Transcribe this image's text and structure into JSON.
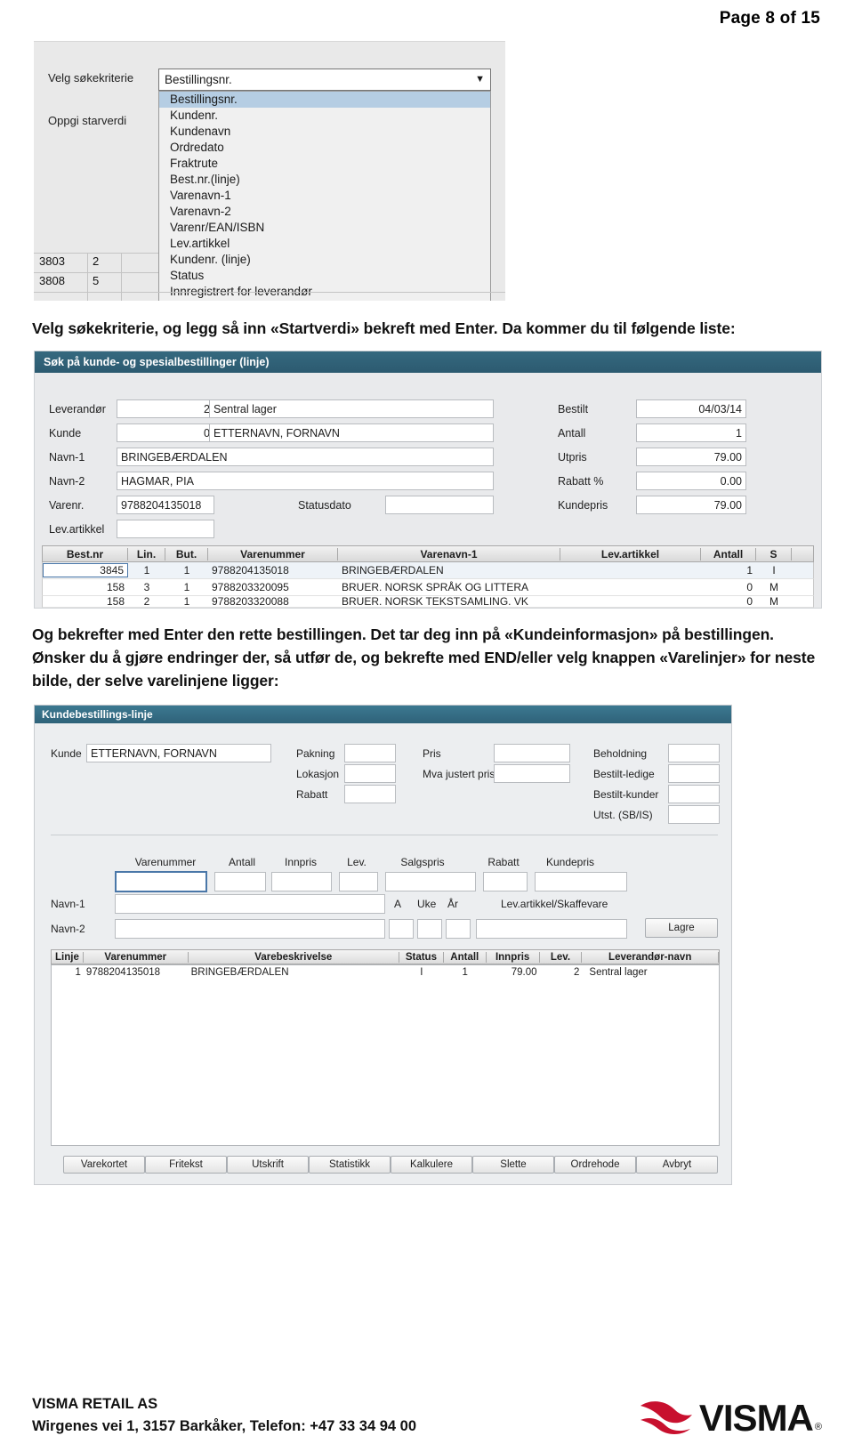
{
  "page": {
    "header": "Page 8 of 15"
  },
  "shot1": {
    "labels": {
      "criteria": "Velg søkekriterie",
      "startvalue": "Oppgi starverdi"
    },
    "combo_value": "Bestillingsnr.",
    "arrow_icon": "chevron-down-icon",
    "options": [
      "Bestillingsnr.",
      "Kundenr.",
      "Kundenavn",
      "Ordredato",
      "Fraktrute",
      "Best.nr.(linje)",
      "Varenavn-1",
      "Varenavn-2",
      "Varenr/EAN/ISBN",
      "Lev.artikkel",
      "Kundenr. (linje)",
      "Status",
      "Innregistrert for leverandør"
    ],
    "selected_option": "Bestillingsnr.",
    "partial_rows": [
      {
        "a": "3803",
        "b": "2"
      },
      {
        "a": "3808",
        "b": "5"
      }
    ]
  },
  "paragraph1": "Velg søkekriterie, og legg så inn «Startverdi» bekreft med Enter. Da kommer du til følgende liste:",
  "paragraph2": "Og bekrefter med Enter den rette bestillingen. Det tar deg inn på «Kundeinformasjon» på bestillingen. Ønsker du å gjøre endringer der, så utfør de, og bekrefte med END/eller velg knappen «Varelinjer» for neste bilde, der selve varelinjene ligger:",
  "shot2": {
    "title": "Søk på kunde- og spesialbestillinger (linje)",
    "labels": {
      "leverandor": "Leverandør",
      "kunde": "Kunde",
      "navn1": "Navn-1",
      "navn2": "Navn-2",
      "varenr": "Varenr.",
      "levartikkel": "Lev.artikkel",
      "statusdato": "Statusdato",
      "bestilt": "Bestilt",
      "antall": "Antall",
      "utpris": "Utpris",
      "rabatt": "Rabatt %",
      "kundepris": "Kundepris"
    },
    "values": {
      "leverandor_nr": "2",
      "leverandor_navn": "Sentral lager",
      "kunde_nr": "0",
      "kunde_navn": "ETTERNAVN, FORNAVN",
      "navn1": "BRINGEBÆRDALEN",
      "navn2": "HAGMAR, PIA",
      "varenr": "9788204135018",
      "levartikkel": "",
      "statusdato": "",
      "bestilt": "04/03/14",
      "antall": "1",
      "utpris": "79.00",
      "rabatt": "0.00",
      "kundepris": "79.00"
    },
    "table": {
      "columns": [
        "Best.nr",
        "Lin.",
        "But.",
        "Varenummer",
        "Varenavn-1",
        "Lev.artikkel",
        "Antall",
        "S"
      ],
      "rows": [
        {
          "bestnr": "3845",
          "lin": "1",
          "but": "1",
          "varenummer": "9788204135018",
          "varenavn": "BRINGEBÆRDALEN",
          "levartikkel": "",
          "antall": "1",
          "s": "I"
        },
        {
          "bestnr": "158",
          "lin": "3",
          "but": "1",
          "varenummer": "9788203320095",
          "varenavn": "BRUER. NORSK SPRÅK OG LITTERA",
          "levartikkel": "",
          "antall": "0",
          "s": "M"
        },
        {
          "bestnr": "158",
          "lin": "2",
          "but": "1",
          "varenummer": "9788203320088",
          "varenavn": "BRUER. NORSK TEKSTSAMLING. VK",
          "levartikkel": "",
          "antall": "0",
          "s": "M"
        }
      ]
    }
  },
  "shot3": {
    "title": "Kundebestillings-linje",
    "labels": {
      "kunde": "Kunde",
      "pakning": "Pakning",
      "lokasjon": "Lokasjon",
      "rabatt": "Rabatt",
      "pris": "Pris",
      "mva": "Mva justert pris",
      "beholdning": "Beholdning",
      "bestit_ledige": "Bestilt-ledige",
      "bestit_kunder": "Bestilt-kunder",
      "utst": "Utst. (SB/IS)",
      "navn1": "Navn-1",
      "navn2": "Navn-2",
      "a": "A",
      "uke": "Uke",
      "ar": "År",
      "levartikkel_skaffevare": "Lev.artikkel/Skaffevare"
    },
    "values": {
      "kunde": "ETTERNAVN, FORNAVN",
      "pakning": "",
      "lokasjon": "",
      "rabatt": "",
      "pris": "",
      "mva": "",
      "beholdning": "",
      "bestit_ledige": "",
      "bestit_kunder": "",
      "utst": "",
      "navn1": "",
      "navn2": ""
    },
    "line_headers": [
      "Varenummer",
      "Antall",
      "Innpris",
      "Lev.",
      "Salgspris",
      "Rabatt",
      "Kundepris"
    ],
    "save_button": "Lagre",
    "grid": {
      "columns": [
        "Linje",
        "Varenummer",
        "Varebeskrivelse",
        "Status",
        "Antall",
        "Innpris",
        "Lev.",
        "Leverandør-navn"
      ],
      "rows": [
        {
          "linje": "1",
          "varenummer": "9788204135018",
          "varebeskrivelse": "BRINGEBÆRDALEN",
          "status": "I",
          "antall": "1",
          "innpris": "79.00",
          "lev": "2",
          "leverandornavn": "Sentral lager"
        }
      ]
    },
    "buttons": [
      "Varekortet",
      "Fritekst",
      "Utskrift",
      "Statistikk",
      "Kalkulere",
      "Slette",
      "Ordrehode",
      "Avbryt"
    ]
  },
  "footer": {
    "company": "VISMA RETAIL AS",
    "address": "Wirgenes vei 1, 3157 Barkåker, Telefon: +47 33 34 94 00",
    "logo_word": "VISMA",
    "logo_reg": "®",
    "logo_mark": "visma-swoosh-icon",
    "logo_color": "#c8102e"
  }
}
